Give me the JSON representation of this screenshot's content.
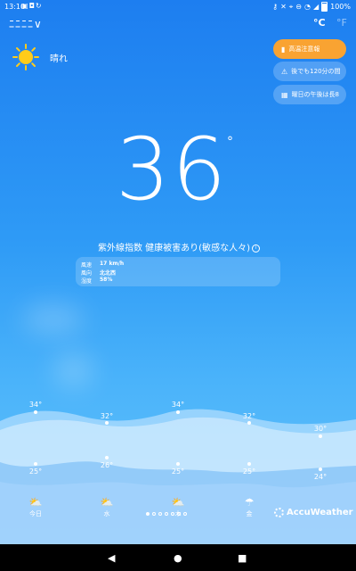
{
  "status_bar": {
    "time": "13:10",
    "left_icons": [
      "screenshot-icon",
      "notification-icon",
      "sync-icon"
    ],
    "right_icons": [
      "key-icon",
      "mute-icon",
      "location-icon",
      "dnd-icon",
      "wifi-icon",
      "signal-icon",
      "battery-icon"
    ],
    "battery": "100%"
  },
  "header": {
    "location": "ﾆﾆﾆﾆ∨",
    "unit_c": "°C",
    "unit_f": "°F"
  },
  "current": {
    "condition": "晴れ",
    "temperature": "36",
    "degree_symbol": "°",
    "uv_text": "紫外線指数  健康被害あり(敏感な人々)",
    "details": [
      {
        "label": "風速",
        "value": "17 km/h"
      },
      {
        "label": "風向",
        "value": "北北西"
      },
      {
        "label": "湿度",
        "value": "58%"
      }
    ]
  },
  "alerts": [
    {
      "icon": "warning-card-icon",
      "text": "高温注意報"
    },
    {
      "icon": "warning-triangle-icon",
      "text": "後でも120分の間"
    },
    {
      "icon": "calendar-icon",
      "text": "曜日の午後は長8"
    }
  ],
  "forecast": {
    "highs": [
      "34°",
      "32°",
      "34°",
      "32°",
      "30°"
    ],
    "lows": [
      "25°",
      "26°",
      "25°",
      "25°",
      "24°"
    ],
    "days": [
      {
        "label": "今日",
        "icon": "partly-sunny-icon"
      },
      {
        "label": "水",
        "icon": "partly-sunny-icon"
      },
      {
        "label": "木",
        "icon": "partly-sunny-icon"
      },
      {
        "label": "金",
        "icon": "rain-cloud-icon"
      }
    ],
    "pager": {
      "count": 7,
      "active": 0
    }
  },
  "brand": "AccuWeather",
  "colors": {
    "sky_top": "#1d7ef0",
    "sky_bottom": "#68c4fb",
    "alert_orange": "#f9a332",
    "sun": "#ffcc1a"
  }
}
